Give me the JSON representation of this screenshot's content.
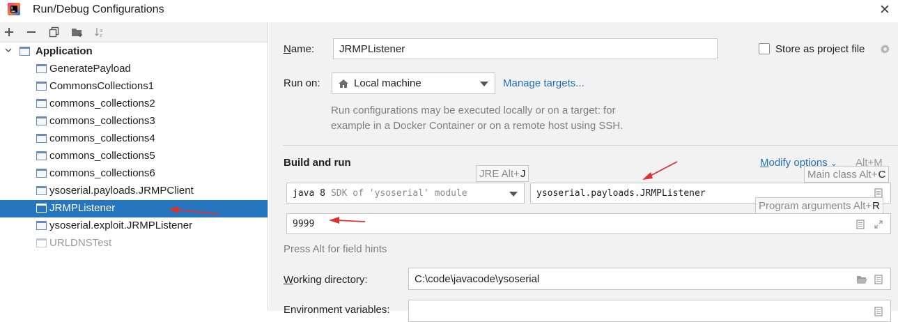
{
  "window": {
    "title": "Run/Debug Configurations",
    "close_glyph": "✕"
  },
  "toolbar": {
    "icons": [
      "add-icon",
      "remove-icon",
      "copy-icon",
      "new-folder-icon",
      "sort-icon"
    ]
  },
  "tree": {
    "group_label": "Application",
    "items": [
      {
        "label": "GeneratePayload",
        "state": "normal"
      },
      {
        "label": "CommonsCollections1",
        "state": "normal"
      },
      {
        "label": "commons_collections2",
        "state": "normal"
      },
      {
        "label": "commons_collections3",
        "state": "normal"
      },
      {
        "label": "commons_collections4",
        "state": "normal"
      },
      {
        "label": "commons_collections5",
        "state": "normal"
      },
      {
        "label": "commons_collections6",
        "state": "normal"
      },
      {
        "label": "ysoserial.payloads.JRMPClient",
        "state": "normal"
      },
      {
        "label": "JRMPListener",
        "state": "selected"
      },
      {
        "label": "ysoserial.exploit.JRMPListener",
        "state": "normal"
      },
      {
        "label": "URLDNSTest",
        "state": "dim"
      }
    ]
  },
  "form": {
    "name_label_mn": "N",
    "name_label_rest": "ame:",
    "name_value": "JRMPListener",
    "store_label": "Store as project file",
    "run_on_label": "Run on:",
    "run_on_value": "Local machine",
    "manage_targets": "Manage targets...",
    "run_on_hint_1": "Run configurations may be executed locally or on a target: for",
    "run_on_hint_2": "example in a Docker Container or on a remote host using SSH.",
    "build_run_title": "Build and run",
    "modify_options_mn": "M",
    "modify_options_rest": "odify options",
    "modify_shortcut": "Alt+M",
    "jre_java": "java 8",
    "jre_sdk": "SDK of 'ysoserial' module",
    "main_class": "ysoserial.payloads.JRMPListener",
    "program_args": "9999",
    "press_alt_hint": "Press Alt for field hints",
    "working_dir_label_mn": "W",
    "working_dir_label_rest": "orking directory:",
    "working_dir_value": "C:\\code\\javacode\\ysoserial",
    "env_label": "Environment variables:"
  },
  "tooltips": {
    "jre": {
      "text": "JRE Alt+",
      "key": "J"
    },
    "main_class": {
      "text": "Main class Alt+",
      "key": "C"
    },
    "program_args": {
      "text": "Program arguments Alt+",
      "key": "R"
    }
  },
  "colors": {
    "selection": "#2675bf",
    "link": "#2470b3",
    "annotation_arrow": "#e03030"
  }
}
